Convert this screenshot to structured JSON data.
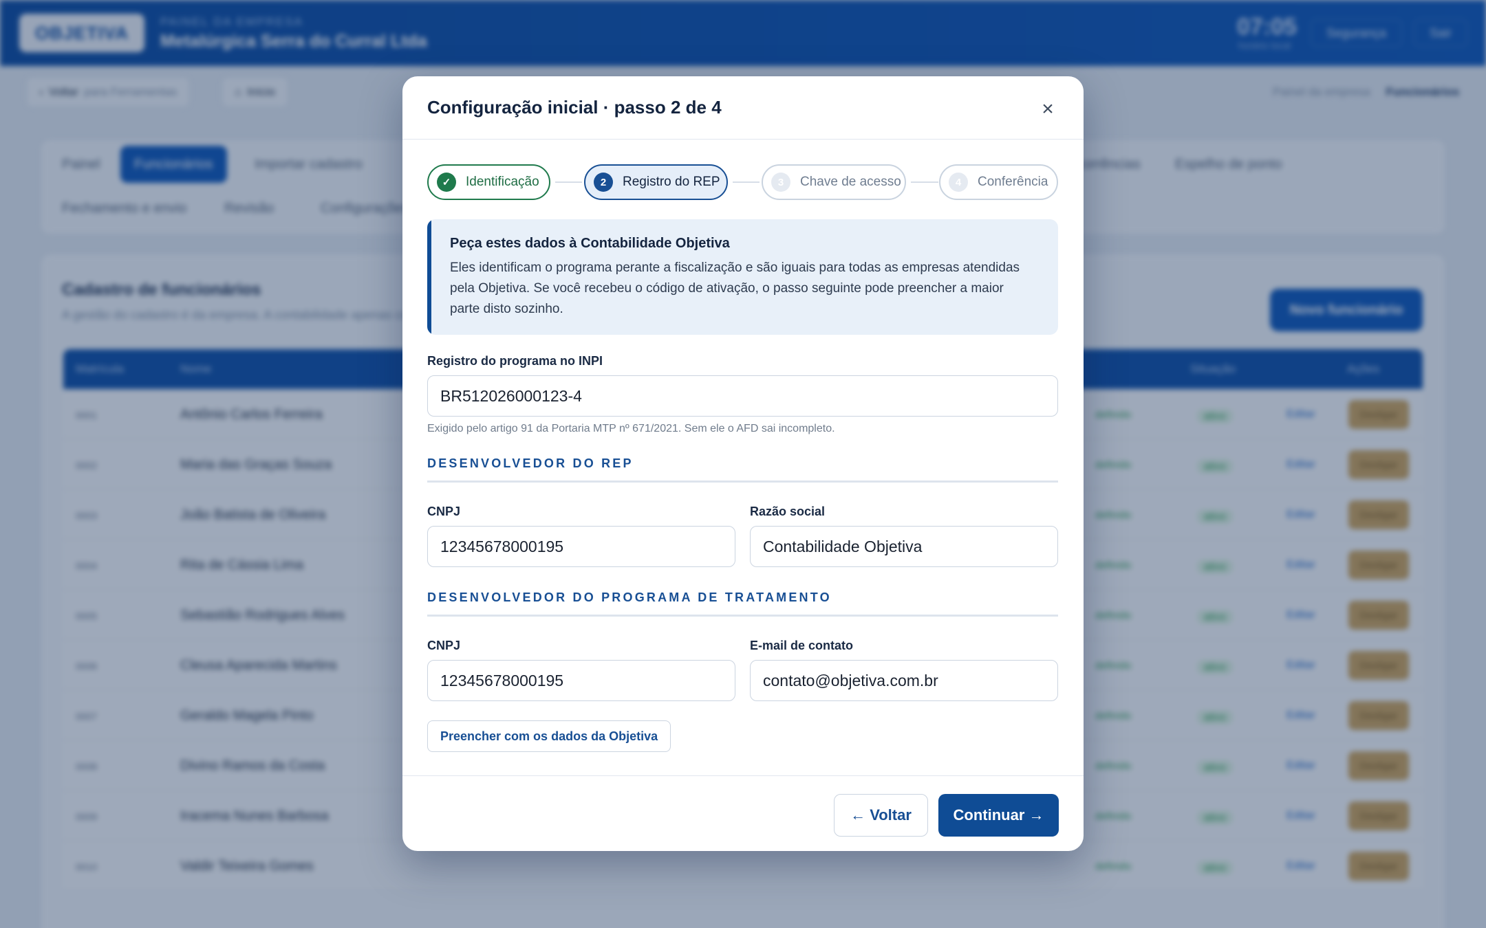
{
  "app": {
    "logo_text": "OBJETIVA",
    "kicker": "PAINEL DA EMPRESA",
    "company": "Metalúrgica Serra do Curral Ltda",
    "clock": "07:05",
    "clock_sub": "horário local",
    "top_links": [
      "Segurança",
      "Sair"
    ],
    "back_label": "Voltar",
    "back_sub": "para Ferramentas",
    "home_label": "Início",
    "crumb_parent": "Painel da empresa",
    "crumb_current": "Funcionários",
    "tabs_row1": [
      "Painel",
      "Funcionários",
      "Importar cadastro",
      "Ocorrências",
      "Espelho de ponto"
    ],
    "tabs_row2": [
      "Fechamento e envio",
      "Revisão",
      "Configurações"
    ],
    "list_title": "Cadastro de funcionários",
    "list_sub": "A gestão do cadastro é da empresa. A contabilidade apenas consulta.",
    "new_button": "Novo funcionário",
    "columns": [
      "Matrícula",
      "Nome",
      "Situação",
      "Ações"
    ],
    "rows": [
      {
        "mat": "0001",
        "name": "Antônio Carlos Ferreira"
      },
      {
        "mat": "0002",
        "name": "Maria das Graças Souza"
      },
      {
        "mat": "0003",
        "name": "João Batista de Oliveira"
      },
      {
        "mat": "0004",
        "name": "Rita de Cássia Lima"
      },
      {
        "mat": "0005",
        "name": "Sebastião Rodrigues Alves"
      },
      {
        "mat": "0006",
        "name": "Cleusa Aparecida Martins"
      },
      {
        "mat": "0007",
        "name": "Geraldo Magela Pinto"
      },
      {
        "mat": "0008",
        "name": "Divino Ramos da Costa"
      },
      {
        "mat": "0009",
        "name": "Iracema Nunes Barbosa"
      },
      {
        "mat": "0010",
        "name": "Valdir Teixeira Gomes"
      }
    ],
    "row_status": "ativo",
    "row_doc": "definido",
    "row_edit": "Editar",
    "row_action": "Desligar"
  },
  "modal": {
    "title": "Configuração inicial · passo 2 de 4",
    "close_icon": "×",
    "steps": [
      {
        "num": "✓",
        "label": "Identificação",
        "state": "done"
      },
      {
        "num": "2",
        "label": "Registro do REP",
        "state": "active"
      },
      {
        "num": "3",
        "label": "Chave de acesso",
        "state": "pending"
      },
      {
        "num": "4",
        "label": "Conferência",
        "state": "pending"
      }
    ],
    "info_title": "Peça estes dados à Contabilidade Objetiva",
    "info_text": "Eles identificam o programa perante a fiscalização e são iguais para todas as empresas atendidas pela Objetiva. Se você recebeu o código de ativação, o passo seguinte pode preencher a maior parte disto sozinho.",
    "inpi_label": "Registro do programa no INPI",
    "inpi_value": "BR512026000123-4",
    "inpi_hint": "Exigido pelo artigo 91 da Portaria MTP nº 671/2021. Sem ele o AFD sai incompleto.",
    "section_rep": "DESENVOLVEDOR DO REP",
    "rep_cnpj_label": "CNPJ",
    "rep_cnpj_value": "12345678000195",
    "rep_razao_label": "Razão social",
    "rep_razao_value": "Contabilidade Objetiva",
    "section_trat": "DESENVOLVEDOR DO PROGRAMA DE TRATAMENTO",
    "trat_cnpj_label": "CNPJ",
    "trat_cnpj_value": "12345678000195",
    "trat_email_label": "E-mail de contato",
    "trat_email_value": "contato@objetiva.com.br",
    "fill_button": "Preencher com os dados da Objetiva",
    "back_button": "← Voltar",
    "next_button": "Continuar →"
  },
  "colors": {
    "primary": "#0f4c95",
    "success": "#1f7a4c",
    "accent_bg": "#e8f0f9"
  }
}
